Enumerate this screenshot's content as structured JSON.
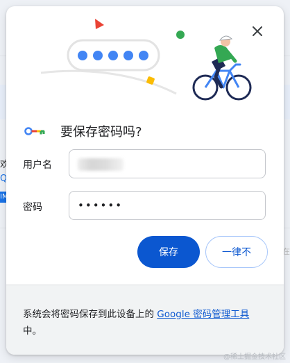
{
  "background": {
    "fragment_a": "欢",
    "fragment_b": "Q/",
    "fragment_c": "IM",
    "fragment_d": "在"
  },
  "dialog": {
    "title": "要保存密码吗?",
    "close_icon": "close-icon",
    "key_icon": "key-icon",
    "username": {
      "label": "用户名",
      "value": ""
    },
    "password": {
      "label": "密码",
      "value": "••••••"
    },
    "save_button": "保存",
    "never_button": "一律不",
    "footer": {
      "text_before": "系统会将密码保存到此设备上的 ",
      "link": "Google 密码管理工具",
      "text_after": "中。"
    },
    "illustration_dots": 5
  },
  "colors": {
    "accent": "#0b57d0",
    "blue_dot": "#4285f4",
    "red": "#ea4335",
    "yellow": "#fbbc04",
    "green": "#34a853"
  },
  "watermark": "@稀土掘金技术社区"
}
